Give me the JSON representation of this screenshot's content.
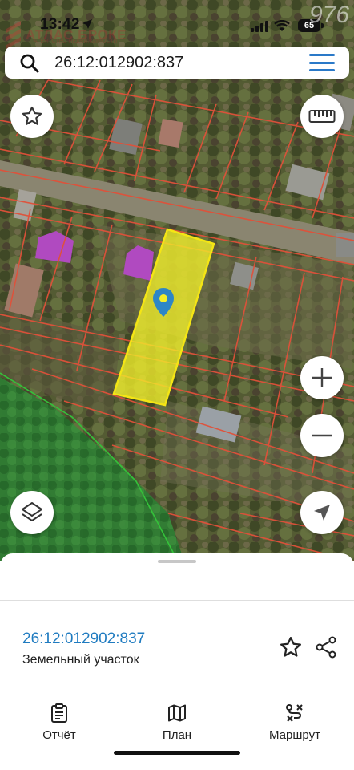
{
  "status": {
    "time": "13:42",
    "battery": "65",
    "watermark_title": "АТЛАС БРОКЕ",
    "watermark_sub": "АГЕНТСТВО НЕДВИЖИМОСТИ",
    "corner_number": "976"
  },
  "search": {
    "query": "26:12:012902:837"
  },
  "map": {
    "icons": {
      "favorite": "star-outline-icon",
      "ruler": "ruler-icon",
      "zoom_in": "plus-icon",
      "zoom_out": "minus-icon",
      "layers": "layers-icon",
      "locate": "navigation-arrow-icon"
    },
    "colors": {
      "parcel_fill": "#f2f02a",
      "parcel_border": "#f4e515",
      "boundary_lines": "#e0513a",
      "forest_zone": "#2f9a3a",
      "pin": "#2d86c6"
    }
  },
  "sheet": {
    "parcel_id": "26:12:012902:837",
    "parcel_type": "Земельный участок"
  },
  "nav": {
    "items": [
      {
        "label": "Отчёт",
        "icon": "clipboard-icon"
      },
      {
        "label": "План",
        "icon": "map-icon"
      },
      {
        "label": "Маршрут",
        "icon": "route-icon"
      }
    ]
  },
  "accent": "#1f7bc0"
}
